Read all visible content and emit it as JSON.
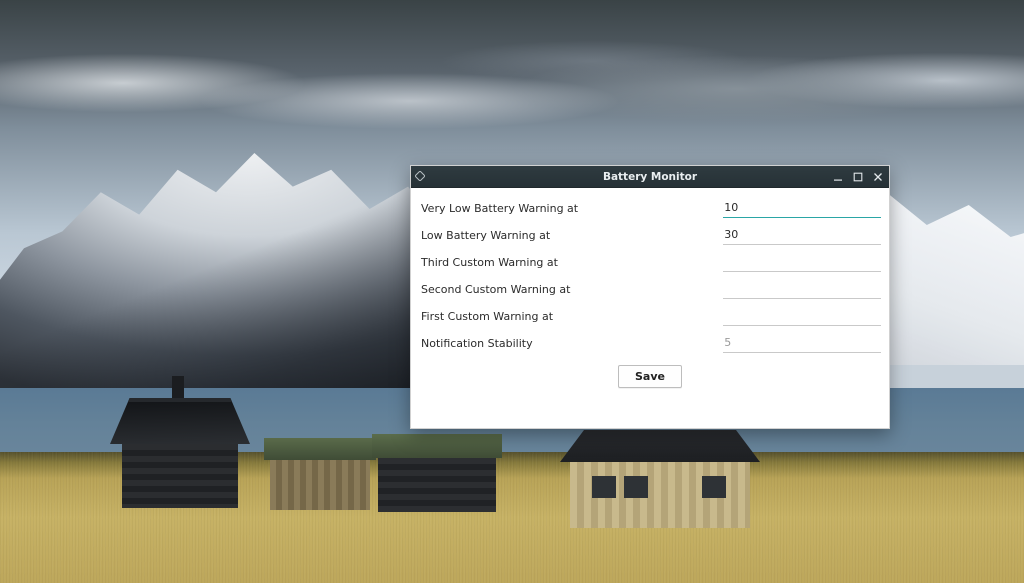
{
  "window": {
    "title": "Battery Monitor",
    "buttons": {
      "minimize": "minimize",
      "maximize": "maximize",
      "close": "close"
    }
  },
  "form": {
    "rows": [
      {
        "label": "Very Low Battery Warning at",
        "value": "10",
        "placeholder": "",
        "focused": true
      },
      {
        "label": "Low Battery Warning at",
        "value": "30",
        "placeholder": "",
        "focused": false
      },
      {
        "label": "Third Custom Warning at",
        "value": "",
        "placeholder": "",
        "focused": false
      },
      {
        "label": "Second Custom Warning at",
        "value": "",
        "placeholder": "",
        "focused": false
      },
      {
        "label": "First Custom Warning at",
        "value": "",
        "placeholder": "",
        "focused": false
      },
      {
        "label": "Notification Stability",
        "value": "",
        "placeholder": "5",
        "focused": false
      }
    ],
    "save_label": "Save"
  }
}
